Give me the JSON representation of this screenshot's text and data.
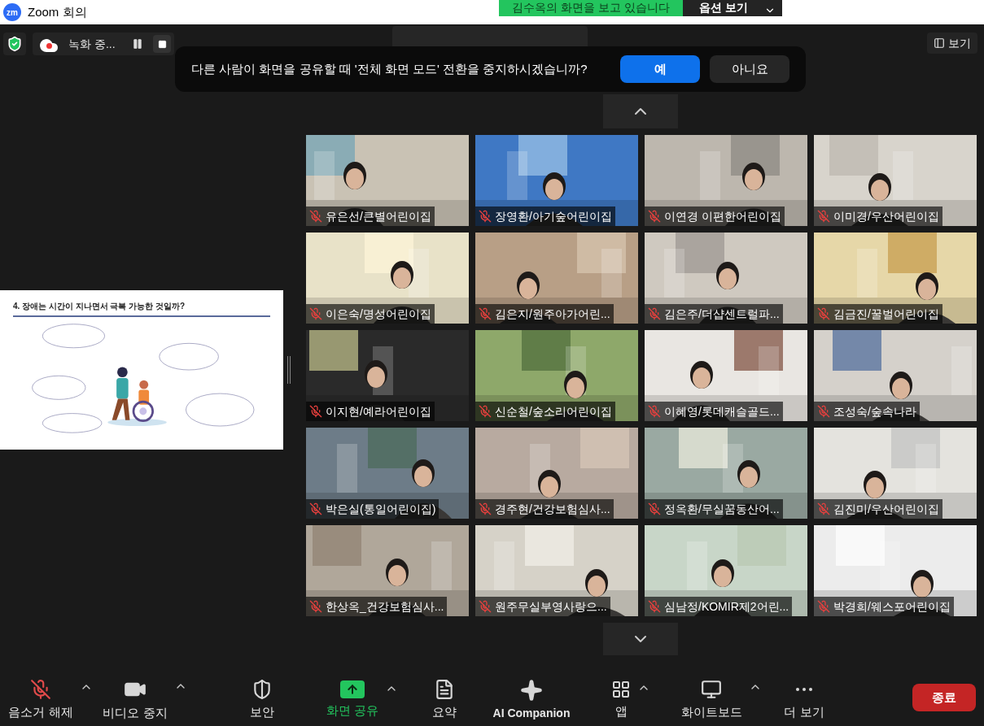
{
  "window": {
    "logo": "zm",
    "title": "Zoom 회의"
  },
  "share_banner": {
    "text": "김수옥의 화면을 보고 있습니다",
    "options": "옵션 보기"
  },
  "top_bar": {
    "recording": "녹화 중...",
    "view": "보기"
  },
  "dialog": {
    "message": "다른 사람이 화면을 공유할 때 '전체 화면 모드' 전환을 중지하시겠습니까?",
    "buttons": [
      {
        "label": "예",
        "primary": true
      },
      {
        "label": "아니요",
        "primary": false
      }
    ]
  },
  "shared_slide": {
    "title": "4. 장애는 시간이 지나면서 극복 가능한 것일까?"
  },
  "participants": [
    {
      "name": "유은선/큰별어린이집",
      "muted": true
    },
    {
      "name": "장영환/아기숲어린이집",
      "muted": true
    },
    {
      "name": "이연경 이편한어린이집",
      "muted": true
    },
    {
      "name": "이미경/우산어린이집",
      "muted": true
    },
    {
      "name": "이은숙/명성어린이집",
      "muted": true
    },
    {
      "name": "김은지/원주아가어린...",
      "muted": true
    },
    {
      "name": "김은주/더샵센트럴파...",
      "muted": true
    },
    {
      "name": "김금진/꿀벌어린이집",
      "muted": true
    },
    {
      "name": "이지현/예라어린이집",
      "muted": true
    },
    {
      "name": "신순철/숲소리어린이집",
      "muted": true
    },
    {
      "name": "이혜영/롯데캐슬골드...",
      "muted": true
    },
    {
      "name": "조성숙/숲속나라",
      "muted": true
    },
    {
      "name": "박은실(통일어린이집)",
      "muted": true
    },
    {
      "name": "경주현/건강보험심사...",
      "muted": true
    },
    {
      "name": "정옥환/무실꿈동산어...",
      "muted": true
    },
    {
      "name": "김진미/우산어린이집",
      "muted": true
    },
    {
      "name": "한상옥_건강보험심사...",
      "muted": true
    },
    {
      "name": "원주무실부영사랑으...",
      "muted": true
    },
    {
      "name": "심남정/KOMIR제2어린...",
      "muted": true
    },
    {
      "name": "박경희/웨스포어린이집",
      "muted": true
    }
  ],
  "toolbar": [
    {
      "kind": "mic",
      "label": "음소거 해제",
      "caret": true
    },
    {
      "kind": "video",
      "label": "비디오 중지",
      "caret": true
    },
    {
      "kind": "security",
      "label": "보안",
      "caret": false
    },
    {
      "kind": "share",
      "label": "화면 공유",
      "caret": true
    },
    {
      "kind": "summary",
      "label": "요약",
      "caret": false
    },
    {
      "kind": "ai",
      "label": "AI Companion",
      "caret": false
    },
    {
      "kind": "apps",
      "label": "앱",
      "caret": true
    },
    {
      "kind": "whiteboard",
      "label": "화이트보드",
      "caret": true
    },
    {
      "kind": "more",
      "label": "더 보기",
      "caret": false
    }
  ],
  "end_button": "종료"
}
